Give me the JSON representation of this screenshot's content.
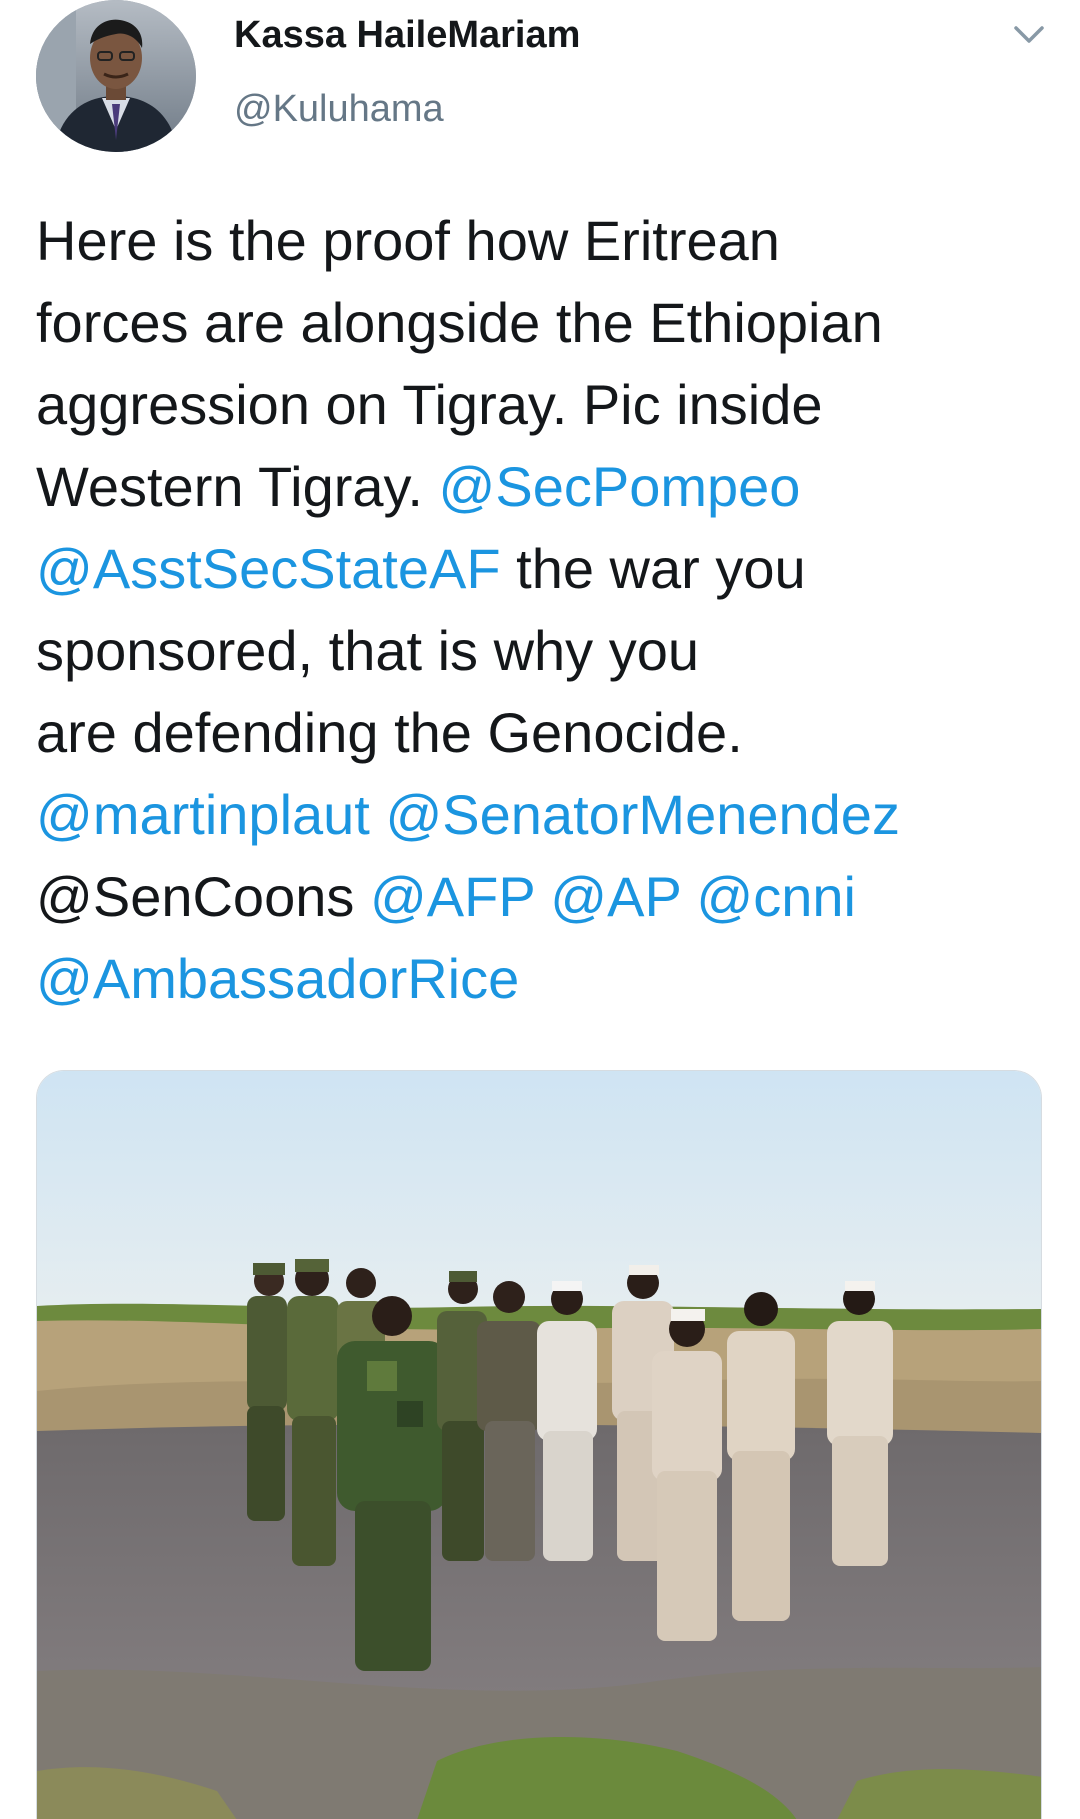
{
  "tweet": {
    "author": {
      "name": "Kassa HaileMariam",
      "handle": "@Kuluhama"
    },
    "lines": [
      [
        {
          "text": "Here is the proof how Eritrean"
        }
      ],
      [
        {
          "text": "forces are alongside the Ethiopian"
        }
      ],
      [
        {
          "text": "aggression on Tigray. Pic inside"
        }
      ],
      [
        {
          "text": "Western Tigray. "
        },
        {
          "text": "@SecPompeo",
          "mention": true
        }
      ],
      [
        {
          "text": "@AsstSecStateAF",
          "mention": true
        },
        {
          "text": " the war you"
        }
      ],
      [
        {
          "text": "sponsored, that is why you"
        }
      ],
      [
        {
          "text": "are defending the Genocide."
        }
      ],
      [
        {
          "text": "@martinplaut",
          "mention": true
        },
        {
          "text": " "
        },
        {
          "text": "@SenatorMenendez",
          "mention": true
        }
      ],
      [
        {
          "text": "@SenCoons"
        },
        {
          "text": " "
        },
        {
          "text": "@AFP",
          "mention": true
        },
        {
          "text": " "
        },
        {
          "text": "@AP",
          "mention": true
        },
        {
          "text": " "
        },
        {
          "text": "@cnni",
          "mention": true
        }
      ],
      [
        {
          "text": "@AmbassadorRice",
          "mention": true
        }
      ]
    ],
    "menu_icon": "chevron-down-icon",
    "media_icon": "photo"
  },
  "colors": {
    "text": "#14171a",
    "secondary": "#657786",
    "mention": "#1b95e0",
    "background": "#ffffff"
  }
}
